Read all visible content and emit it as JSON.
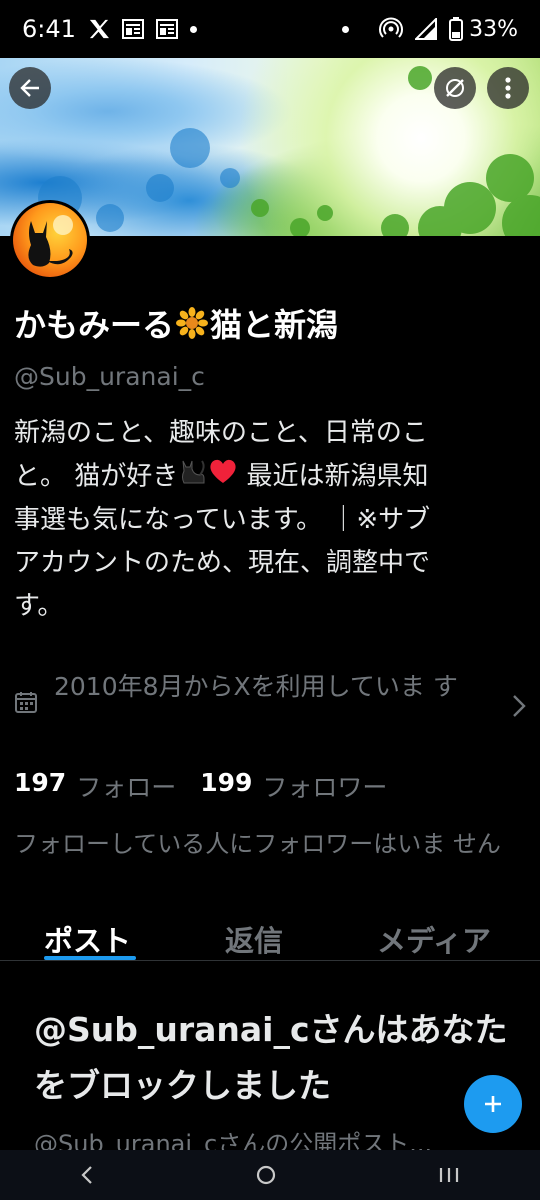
{
  "status_bar": {
    "time": "6:41",
    "battery": "33%"
  },
  "header": {
    "back_icon": "arrow-left-icon",
    "grok_icon": "grok-icon",
    "more_icon": "more-vertical-icon"
  },
  "profile": {
    "name_part1": "かもみーる",
    "name_part2": "猫と新潟",
    "handle": "@Sub_uranai_c",
    "bio_line1": "新潟のこと、趣味のこと、日常のこ",
    "bio_line2_a": "と。 猫が好き",
    "bio_line2_b": " 最近は新潟県知",
    "bio_line3": "事選も気になっています。 ｜※サブ",
    "bio_line4": "アカウントのため、現在、調整中で",
    "bio_line5": "す。",
    "joined_text": "2010年8月からXを利用していま す",
    "following_count": "197",
    "following_label": "フォロー",
    "followers_count": "199",
    "followers_label": "フォロワー",
    "mutual_text": "フォローしている人にフォロワーはいま せん"
  },
  "tabs": [
    {
      "label": "ポスト"
    },
    {
      "label": "返信"
    },
    {
      "label": "メディア"
    }
  ],
  "blocked": {
    "title": "@Sub_uranai_cさんはあなたをブロックしました",
    "subtitle": "@Sub_uranai_cさんの公開ポスト..."
  },
  "colors": {
    "accent": "#1d9bf0",
    "background": "#000000",
    "secondary_text": "#71767b"
  }
}
